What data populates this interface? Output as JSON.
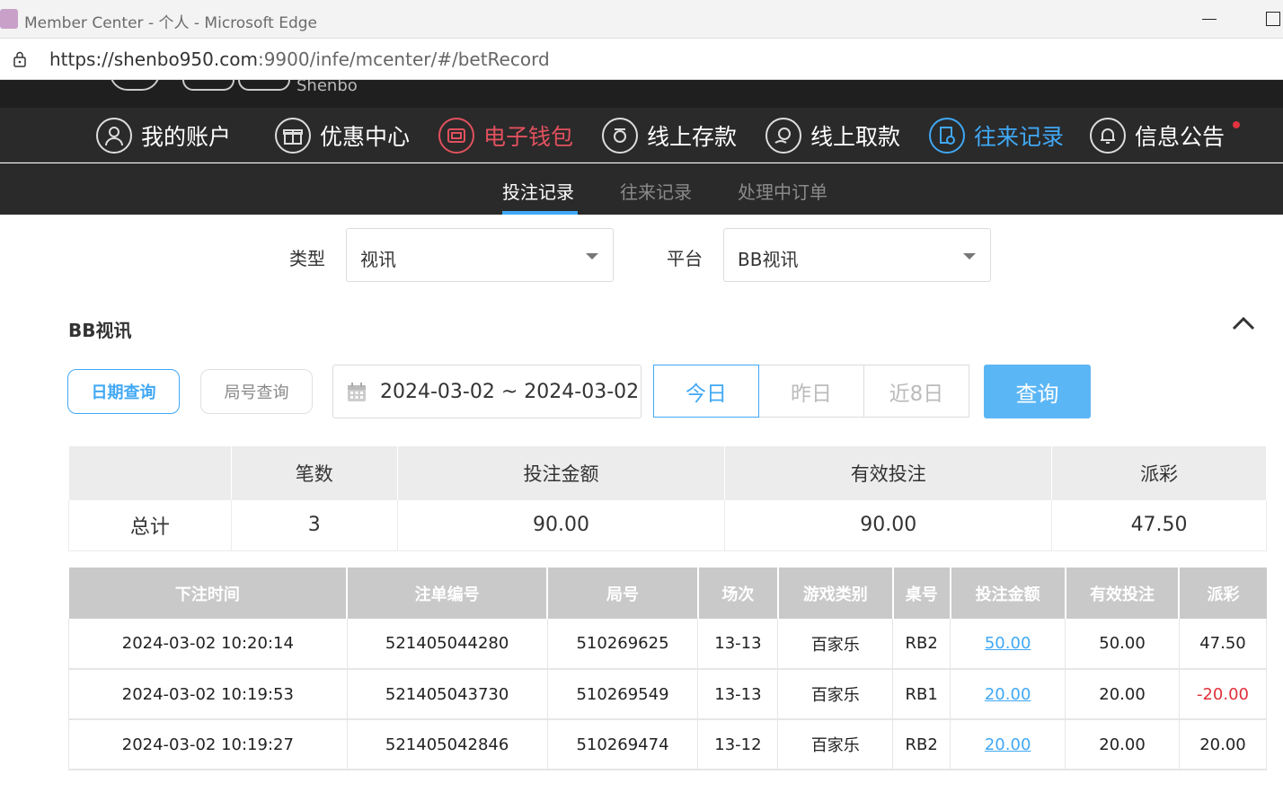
{
  "browser": {
    "window_title": "Member Center - 个人 - Microsoft Edge",
    "url_host": "https://shenbo950.com",
    "url_rest": ":9900/infe/mcenter/#/betRecord"
  },
  "site": {
    "logo_text": "Shenbo"
  },
  "nav": {
    "items": [
      {
        "label": "我的账户",
        "icon": "user-icon"
      },
      {
        "label": "优惠中心",
        "icon": "gift-icon"
      },
      {
        "label": "电子钱包",
        "icon": "wallet-icon"
      },
      {
        "label": "线上存款",
        "icon": "deposit-icon"
      },
      {
        "label": "线上取款",
        "icon": "withdraw-icon"
      },
      {
        "label": "往来记录",
        "icon": "records-icon"
      },
      {
        "label": "信息公告",
        "icon": "bell-icon"
      }
    ]
  },
  "subnav": {
    "tabs": [
      "投注记录",
      "往来记录",
      "处理中订单"
    ]
  },
  "filters": {
    "type_label": "类型",
    "type_value": "视讯",
    "platform_label": "平台",
    "platform_value": "BB视讯"
  },
  "section": {
    "title": "BB视讯"
  },
  "search": {
    "mode_date": "日期查询",
    "mode_round": "局号查询",
    "date_range": "2024-03-02 ~ 2024-03-02",
    "quick": [
      "今日",
      "昨日",
      "近8日"
    ],
    "query_button": "查询"
  },
  "summary": {
    "headers": [
      "",
      "笔数",
      "投注金额",
      "有效投注",
      "派彩"
    ],
    "row": [
      "总计",
      "3",
      "90.00",
      "90.00",
      "47.50"
    ]
  },
  "records": {
    "headers": [
      "下注时间",
      "注单编号",
      "局号",
      "场次",
      "游戏类别",
      "桌号",
      "投注金额",
      "有效投注",
      "派彩"
    ],
    "rows": [
      [
        "2024-03-02 10:20:14",
        "521405044280",
        "510269625",
        "13-13",
        "百家乐",
        "RB2",
        "50.00",
        "50.00",
        "47.50"
      ],
      [
        "2024-03-02 10:19:53",
        "521405043730",
        "510269549",
        "13-13",
        "百家乐",
        "RB1",
        "20.00",
        "20.00",
        "-20.00"
      ],
      [
        "2024-03-02 10:19:27",
        "521405042846",
        "510269474",
        "13-12",
        "百家乐",
        "RB2",
        "20.00",
        "20.00",
        "20.00"
      ]
    ]
  },
  "colors": {
    "accent": "#40a8f5",
    "danger": "#e2515e",
    "negative": "#e0303a"
  }
}
